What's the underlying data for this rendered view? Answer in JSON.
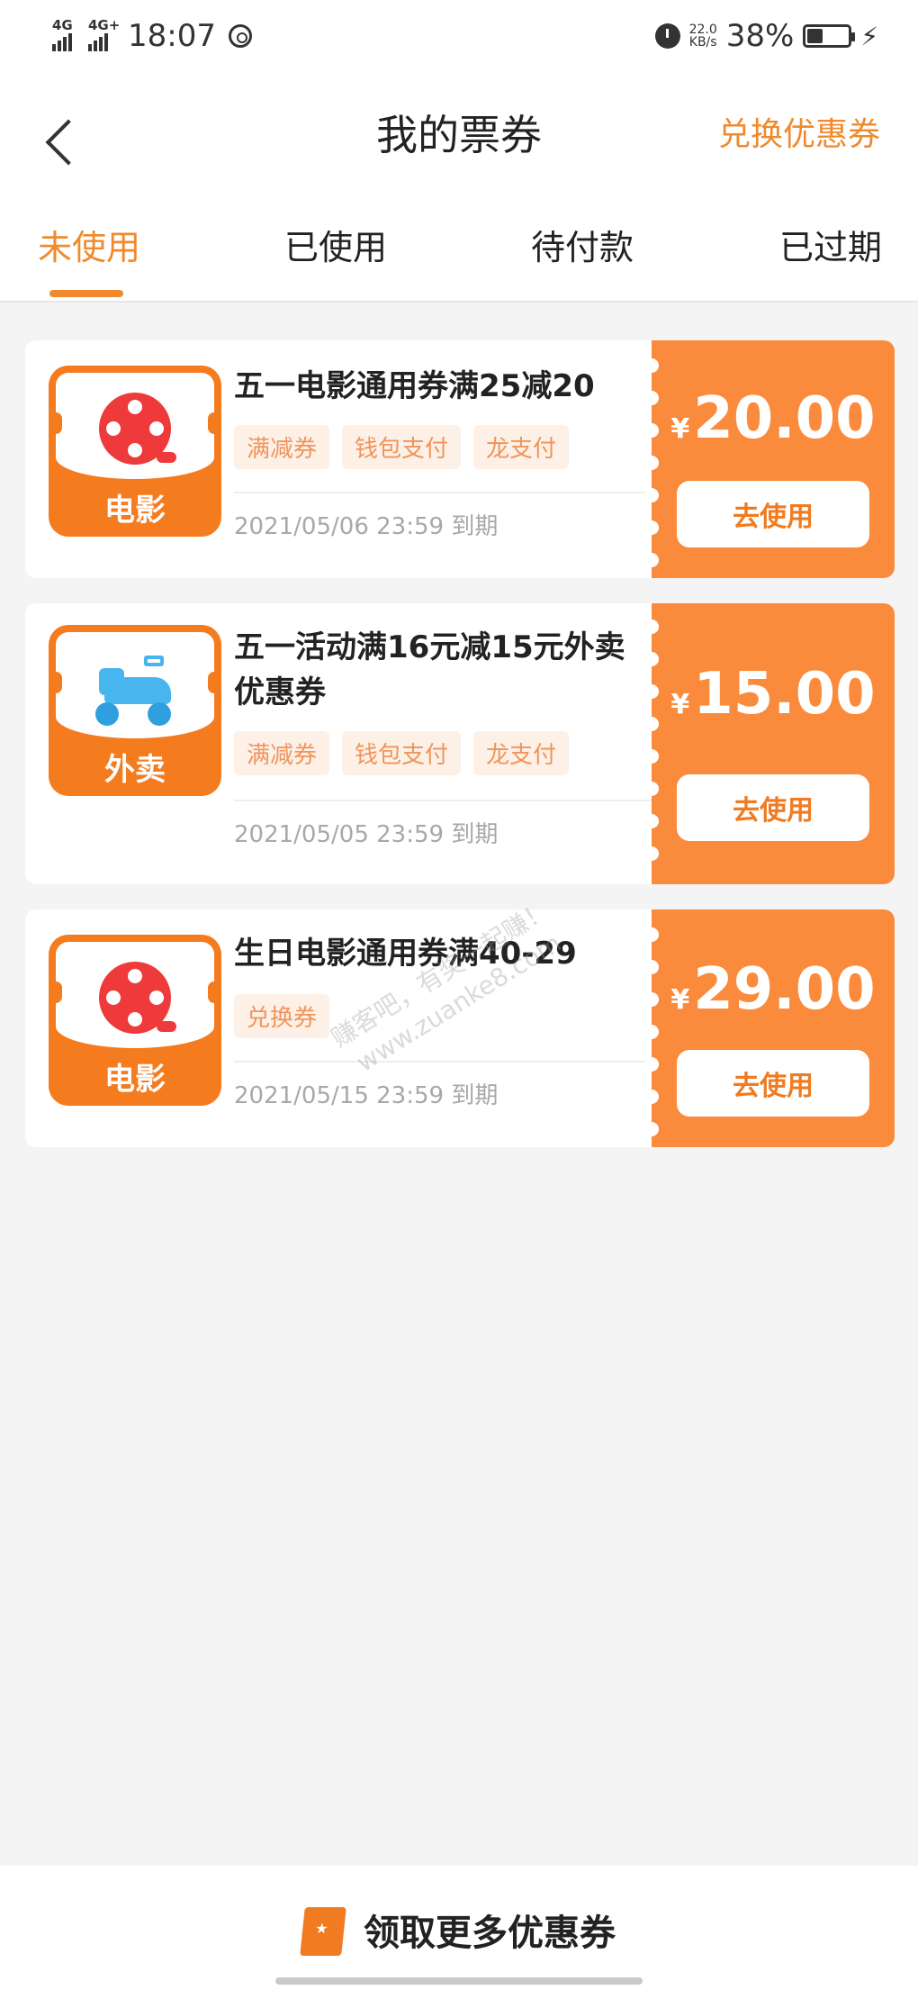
{
  "status_bar": {
    "net1": "4G",
    "net2": "4G+",
    "time": "18:07",
    "speed_value": "22.0",
    "speed_unit": "KB/s",
    "battery": "38%",
    "battery_level": 0.38
  },
  "header": {
    "title": "我的票券",
    "right_link": "兑换优惠券"
  },
  "tabs": [
    "未使用",
    "已使用",
    "待付款",
    "已过期"
  ],
  "active_tab": "未使用",
  "coupons": [
    {
      "icon": "film-reel-icon",
      "category": "电影",
      "title": "五一电影通用券满25减20",
      "tags": [
        "满减券",
        "钱包支付",
        "龙支付"
      ],
      "expiry": "2021/05/06 23:59 到期",
      "currency": "¥",
      "amount": "20.00",
      "button": "去使用"
    },
    {
      "icon": "scooter-icon",
      "category": "外卖",
      "title": "五一活动满16元减15元外卖优惠券",
      "tags": [
        "满减券",
        "钱包支付",
        "龙支付"
      ],
      "expiry": "2021/05/05 23:59 到期",
      "currency": "¥",
      "amount": "15.00",
      "button": "去使用"
    },
    {
      "icon": "film-reel-icon",
      "category": "电影",
      "title": "生日电影通用券满40-29",
      "tags": [
        "兑换券"
      ],
      "expiry": "2021/05/15 23:59 到期",
      "currency": "¥",
      "amount": "29.00",
      "button": "去使用"
    }
  ],
  "watermark": {
    "line1": "赚客吧，有奖一起赚！",
    "line2": "www.zuanke8.com"
  },
  "bottom": {
    "label": "领取更多优惠券"
  },
  "colors": {
    "accent": "#f08a2c",
    "price_panel": "#fb8b3c",
    "tag_bg": "#fdf0e7"
  }
}
